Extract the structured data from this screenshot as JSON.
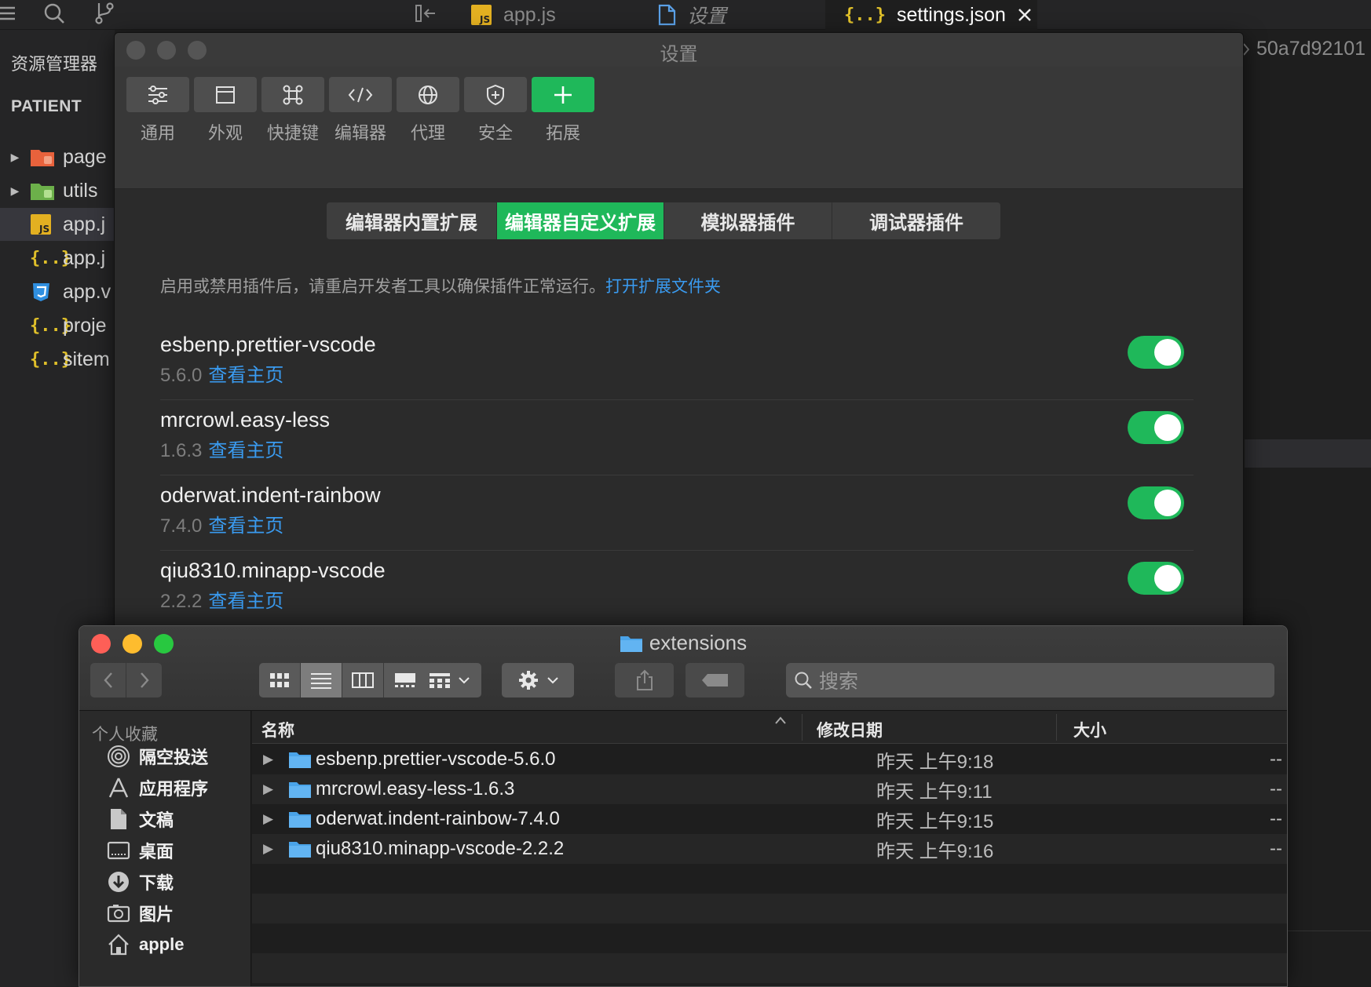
{
  "tabbar": {
    "tabs": [
      {
        "label": "app.js",
        "icon": "js-file-icon"
      },
      {
        "label": "设置",
        "icon": "file-icon"
      },
      {
        "label": "settings.json",
        "icon": "json-file-icon"
      }
    ]
  },
  "sidebar": {
    "title": "资源管理器",
    "section": "PATIENT",
    "items": [
      {
        "label": "page",
        "icon": "folder-icon"
      },
      {
        "label": "utils",
        "icon": "folder-icon"
      },
      {
        "label": "app.j",
        "icon": "js-file-icon"
      },
      {
        "label": "app.j",
        "icon": "json-file-icon"
      },
      {
        "label": "app.v",
        "icon": "css-file-icon"
      },
      {
        "label": "proje",
        "icon": "json-file-icon"
      },
      {
        "label": "sitem",
        "icon": "json-file-icon"
      }
    ]
  },
  "editor": {
    "breadcrumb": "50a7d92101"
  },
  "settings": {
    "title": "设置",
    "toolbar": [
      {
        "label": "通用",
        "icon": "sliders-icon"
      },
      {
        "label": "外观",
        "icon": "window-icon"
      },
      {
        "label": "快捷键",
        "icon": "command-key-icon"
      },
      {
        "label": "编辑器",
        "icon": "code-icon"
      },
      {
        "label": "代理",
        "icon": "globe-icon"
      },
      {
        "label": "安全",
        "icon": "shield-icon"
      },
      {
        "label": "拓展",
        "icon": "plus-icon"
      }
    ],
    "segments": [
      "编辑器内置扩展",
      "编辑器自定义扩展",
      "模拟器插件",
      "调试器插件"
    ],
    "active_segment": "编辑器自定义扩展",
    "notice": "启用或禁用插件后，请重启开发者工具以确保插件正常运行。",
    "notice_link": "打开扩展文件夹",
    "extensions": [
      {
        "name": "esbenp.prettier-vscode",
        "version": "5.6.0",
        "link": "查看主页",
        "enabled": true
      },
      {
        "name": "mrcrowl.easy-less",
        "version": "1.6.3",
        "link": "查看主页",
        "enabled": true
      },
      {
        "name": "oderwat.indent-rainbow",
        "version": "7.4.0",
        "link": "查看主页",
        "enabled": true
      },
      {
        "name": "qiu8310.minapp-vscode",
        "version": "2.2.2",
        "link": "查看主页",
        "enabled": true
      }
    ],
    "accent": "#1fb85a",
    "link_color": "#3a9bf0"
  },
  "finder": {
    "title": "extensions",
    "search_placeholder": "搜索",
    "sidebar_heading": "个人收藏",
    "favorites": [
      {
        "label": "隔空投送",
        "icon": "airdrop-icon"
      },
      {
        "label": "应用程序",
        "icon": "applications-icon"
      },
      {
        "label": "文稿",
        "icon": "documents-icon"
      },
      {
        "label": "桌面",
        "icon": "desktop-icon"
      },
      {
        "label": "下载",
        "icon": "downloads-icon"
      },
      {
        "label": "图片",
        "icon": "pictures-icon"
      },
      {
        "label": "apple",
        "icon": "home-icon"
      }
    ],
    "columns": {
      "name": "名称",
      "modified": "修改日期",
      "size": "大小"
    },
    "rows": [
      {
        "name": "esbenp.prettier-vscode-5.6.0",
        "modified": "昨天 上午9:18",
        "size": "--"
      },
      {
        "name": "mrcrowl.easy-less-1.6.3",
        "modified": "昨天 上午9:11",
        "size": "--"
      },
      {
        "name": "oderwat.indent-rainbow-7.4.0",
        "modified": "昨天 上午9:15",
        "size": "--"
      },
      {
        "name": "qiu8310.minapp-vscode-2.2.2",
        "modified": "昨天 上午9:16",
        "size": "--"
      }
    ]
  }
}
